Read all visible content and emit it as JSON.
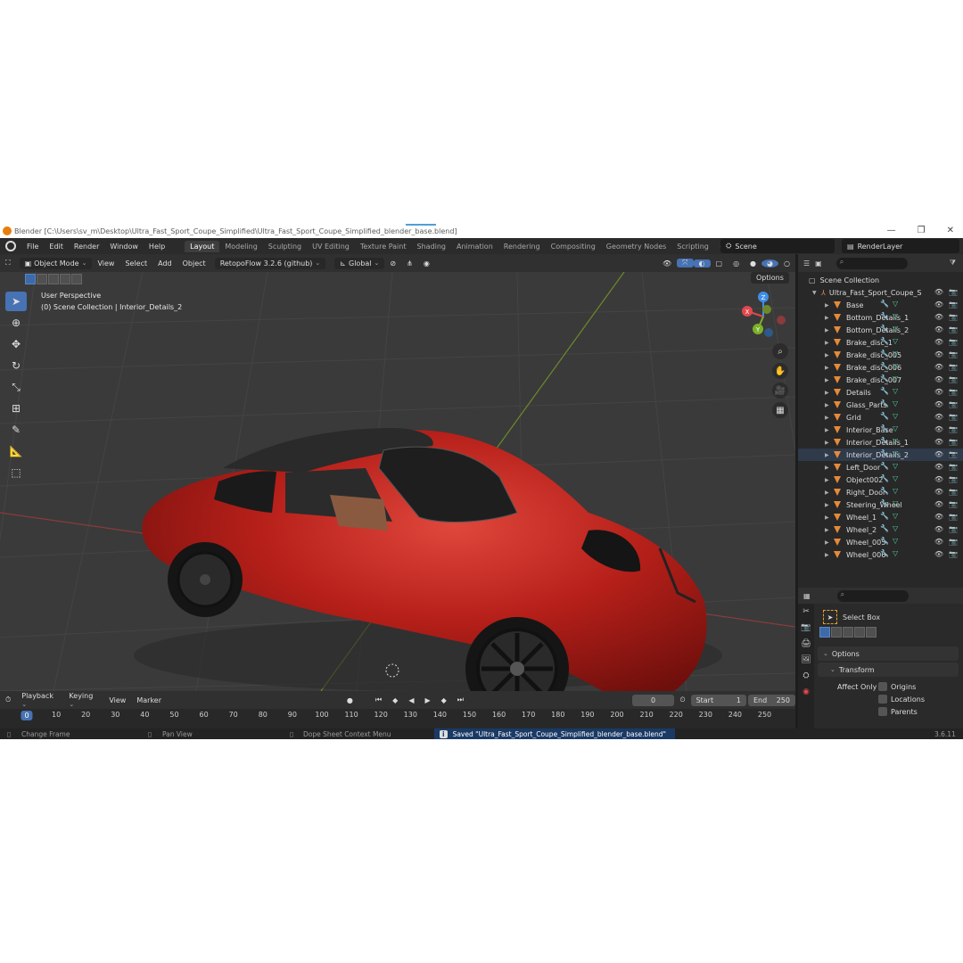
{
  "window": {
    "title": "Blender [C:\\Users\\sv_m\\Desktop\\Ultra_Fast_Sport_Coupe_Simplified\\Ultra_Fast_Sport_Coupe_Simplified_blender_base.blend]",
    "minimize": "—",
    "restore": "❐",
    "close": "✕"
  },
  "menu": {
    "items": [
      "File",
      "Edit",
      "Render",
      "Window",
      "Help"
    ]
  },
  "workspaces": [
    "Layout",
    "Modeling",
    "Sculpting",
    "UV Editing",
    "Texture Paint",
    "Shading",
    "Animation",
    "Rendering",
    "Compositing",
    "Geometry Nodes",
    "Scripting"
  ],
  "workspace_add": "+",
  "scene": "Scene",
  "view_layer": "RenderLayer",
  "viewport_header": {
    "mode": "Object Mode",
    "menus": [
      "View",
      "Select",
      "Add",
      "Object"
    ],
    "addon": "RetopoFlow 3.2.6 (github)",
    "orientation": "Global"
  },
  "viewport": {
    "perspective": "User Perspective",
    "collection_info": "(0) Scene Collection | Interior_Details_2",
    "options_label": "Options"
  },
  "gizmo": {
    "z": "Z",
    "y": "Y",
    "x": "X"
  },
  "outliner": {
    "root": "Scene Collection",
    "collection": "Ultra_Fast_Sport_Coupe_S",
    "objects": [
      "Base",
      "Bottom_Details_1",
      "Bottom_Details_2",
      "Brake_disc_1",
      "Brake_disc_005",
      "Brake_disc_006",
      "Brake_disc_007",
      "Details",
      "Glass_Parts",
      "Grid",
      "Interior_Base",
      "Interior_Details_1",
      "Interior_Details_2",
      "Left_Door",
      "Object002",
      "Right_Door",
      "Steering_Wheel",
      "Wheel_1",
      "Wheel_2",
      "Wheel_005",
      "Wheel_006"
    ],
    "selected": "Interior_Details_2"
  },
  "properties": {
    "tool_name": "Select Box",
    "options_label": "Options",
    "transform_label": "Transform",
    "affect_only_label": "Affect Only",
    "checkboxes": [
      "Origins",
      "Locations",
      "Parents"
    ]
  },
  "timeline": {
    "menus": [
      "Playback",
      "Keying",
      "View",
      "Marker"
    ],
    "current_frame": "0",
    "start_label": "Start",
    "start": "1",
    "end_label": "End",
    "end": "250",
    "ticks": [
      "0",
      "10",
      "20",
      "30",
      "40",
      "50",
      "60",
      "70",
      "80",
      "90",
      "100",
      "110",
      "120",
      "130",
      "140",
      "150",
      "160",
      "170",
      "180",
      "190",
      "200",
      "210",
      "220",
      "230",
      "240",
      "250"
    ]
  },
  "statusbar": {
    "change_frame": "Change Frame",
    "pan_view": "Pan View",
    "context_menu": "Dope Sheet Context Menu",
    "saved_message": "Saved \"Ultra_Fast_Sport_Coupe_Simplified_blender_base.blend\"",
    "info_icon": "i",
    "version": "3.6.11"
  },
  "colors": {
    "accent": "#4772b3",
    "car_red": "#b81f1a",
    "orange_icon": "#e58a3a",
    "axis_x": "#e0484e",
    "axis_y": "#7bb02a",
    "axis_z": "#3f8ee8"
  }
}
